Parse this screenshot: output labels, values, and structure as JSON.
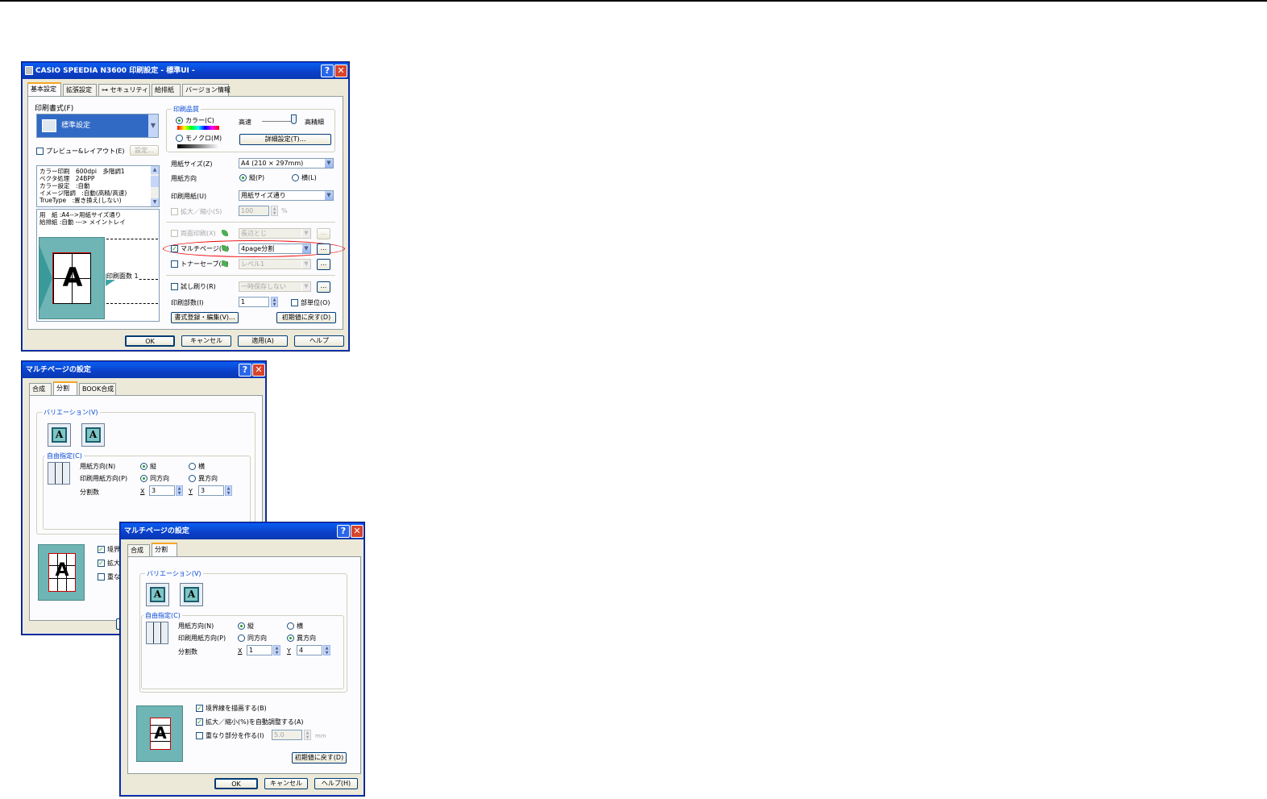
{
  "dialog1": {
    "title": "CASIO SPEEDIA N3600 印刷設定 - 標準UI -",
    "tabs": [
      "基本設定",
      "拡張設定",
      "セキュリティ",
      "給排紙",
      "バージョン情報"
    ],
    "print_style_label": "印刷書式(F)",
    "print_style_value": "標準設定",
    "preview_layout_label": "プレビュー&レイアウト(E)",
    "settings_button": "設定...",
    "summary_lines": [
      "カラー印刷　600dpi　多階調1",
      "ベクタ処理　24BPP",
      "カラー設定　:自動",
      "イメージ階調　:自動(高精/高速)",
      "TrueType　:置き換え(しない)"
    ],
    "paper_lines": [
      "用　紙 :A4-->用紙サイズ通り",
      "給排紙 :自動 ---> メイントレイ"
    ],
    "print_pages_label": "印刷面数 1",
    "quality_group": "印刷品質",
    "color_label": "カラー(C)",
    "mono_label": "モノクロ(M)",
    "speed_label": "高速",
    "fine_label": "高精細",
    "detail_button": "詳細設定(T)...",
    "paper_size_label": "用紙サイズ(Z)",
    "paper_size_value": "A4 (210 × 297mm)",
    "orientation_label": "用紙方向",
    "portrait_label": "縦(P)",
    "landscape_label": "横(L)",
    "print_paper_label": "印刷用紙(U)",
    "print_paper_value": "用紙サイズ通り",
    "zoom_label": "拡大／縮小(S)",
    "zoom_value": "100",
    "zoom_unit": "%",
    "duplex_label": "両面印刷(X)",
    "duplex_value": "長辺とじ",
    "multipage_label": "マルチページ(G)",
    "multipage_value": "4page分割",
    "toner_label": "トナーセーブ(N)",
    "toner_value": "レベル1",
    "trial_label": "試し刷り(R)",
    "trial_value": "一時保存しない",
    "copies_label": "印刷部数(I)",
    "copies_value": "1",
    "collate_label": "部単位(O)",
    "register_button": "書式登録・編集(V)...",
    "reset_button": "初期値に戻す(D)",
    "ellipsis": "...",
    "ok": "OK",
    "cancel": "キャンセル",
    "apply": "適用(A)",
    "help": "ヘルプ"
  },
  "dialog2": {
    "title": "マルチページの設定",
    "tabs": [
      "合成",
      "分割",
      "BOOK合成"
    ],
    "variation_label": "バリエーション(V)",
    "free_label": "自由指定(C)",
    "orientation_label": "用紙方向(N)",
    "portrait_label": "縦",
    "landscape_label": "横",
    "print_dir_label": "印刷用紙方向(P)",
    "same_dir_label": "同方向",
    "diff_dir_label": "異方向",
    "split_label": "分割数",
    "x_label": "X",
    "x_value": "3",
    "y_label": "Y",
    "y_value": "3",
    "border_label": "境界",
    "zoom_label": "拡大",
    "overlap_label": "重な"
  },
  "dialog3": {
    "title": "マルチページの設定",
    "tabs": [
      "合成",
      "分割"
    ],
    "variation_label": "バリエーション(V)",
    "free_label": "自由指定(C)",
    "orientation_label": "用紙方向(N)",
    "portrait_label": "縦",
    "landscape_label": "横",
    "print_dir_label": "印刷用紙方向(P)",
    "same_dir_label": "同方向",
    "diff_dir_label": "異方向",
    "split_label": "分割数",
    "x_label": "X",
    "x_value": "1",
    "y_label": "Y",
    "y_value": "4",
    "border_label": "境界線を描画する(B)",
    "autofit_label": "拡大／縮小(%)を自動調整する(A)",
    "overlap_label": "重なり部分を作る(I)",
    "overlap_value": "5.0",
    "overlap_unit": "mm",
    "reset_button": "初期値に戻す(D)",
    "ok": "OK",
    "cancel": "キャンセル",
    "help": "ヘルプ(H)"
  }
}
